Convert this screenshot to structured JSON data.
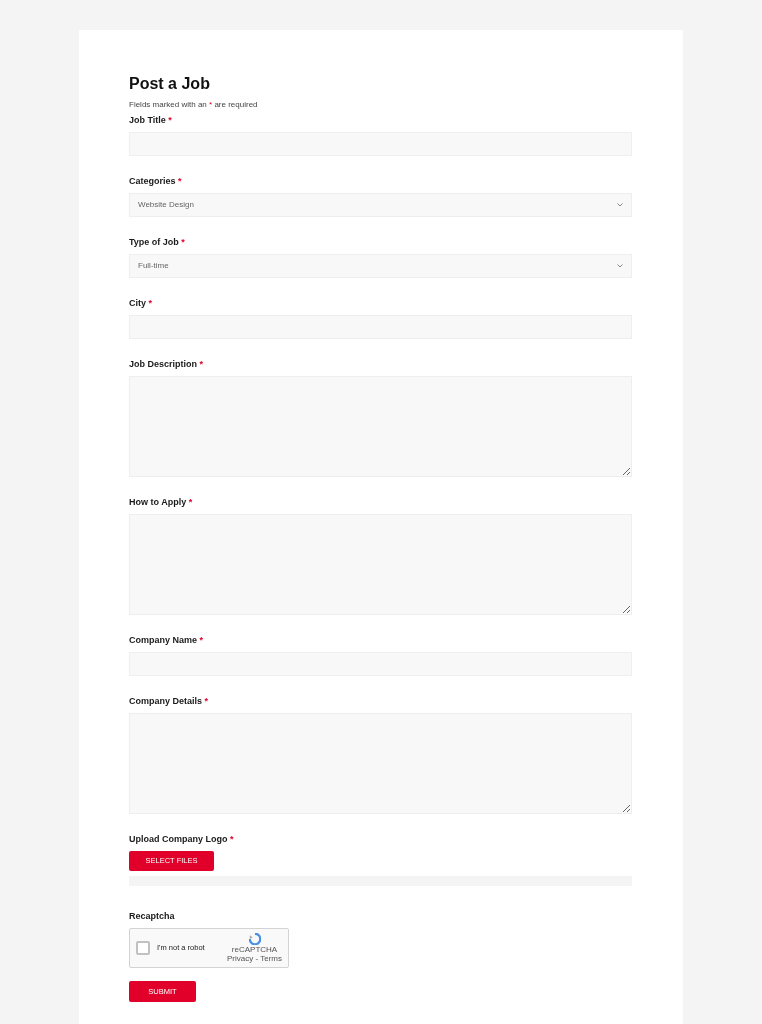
{
  "title": "Post a Job",
  "note": {
    "before": "Fields marked with an",
    "mark": "*",
    "after": "are required"
  },
  "fields": [
    {
      "kind": "text",
      "label": "Job Title",
      "required_mark": "*"
    },
    {
      "kind": "select",
      "label": "Categories",
      "required_mark": "*",
      "value": "Website Design"
    },
    {
      "kind": "select",
      "label": "Type of Job",
      "required_mark": "*",
      "value": "Full-time"
    },
    {
      "kind": "text",
      "label": "City",
      "required_mark": "*"
    },
    {
      "kind": "textarea",
      "label": "Job Description",
      "required_mark": "*"
    },
    {
      "kind": "textarea",
      "label": "How to Apply",
      "required_mark": "*"
    },
    {
      "kind": "text",
      "label": "Company Name",
      "required_mark": "*"
    },
    {
      "kind": "textarea",
      "label": "Company Details",
      "required_mark": "*"
    },
    {
      "kind": "upload",
      "label": "Upload Company Logo",
      "required_mark": "*",
      "button": "SELECT FILES"
    }
  ],
  "recaptcha": {
    "label": "Recaptcha",
    "checked": false,
    "text": "I'm not a robot",
    "brand": "reCAPTCHA",
    "links": "Privacy - Terms"
  },
  "submit": "SUBMIT"
}
